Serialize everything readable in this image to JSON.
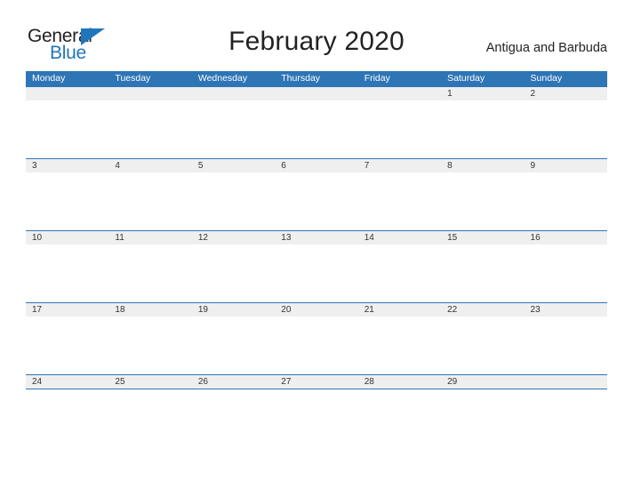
{
  "logo": {
    "primary_text": "General",
    "secondary_text": "Blue",
    "flag_icon": "triangle-flag-icon",
    "primary_color": "#231f20",
    "secondary_color": "#1f76bc"
  },
  "header": {
    "title": "February 2020",
    "locale": "Antigua and Barbuda"
  },
  "calendar": {
    "accent_color": "#2e75b6",
    "band_color": "#efefef",
    "weekdays": [
      "Monday",
      "Tuesday",
      "Wednesday",
      "Thursday",
      "Friday",
      "Saturday",
      "Sunday"
    ],
    "weeks": [
      [
        "",
        "",
        "",
        "",
        "",
        "1",
        "2"
      ],
      [
        "3",
        "4",
        "5",
        "6",
        "7",
        "8",
        "9"
      ],
      [
        "10",
        "11",
        "12",
        "13",
        "14",
        "15",
        "16"
      ],
      [
        "17",
        "18",
        "19",
        "20",
        "21",
        "22",
        "23"
      ],
      [
        "24",
        "25",
        "26",
        "27",
        "28",
        "29",
        ""
      ]
    ]
  }
}
